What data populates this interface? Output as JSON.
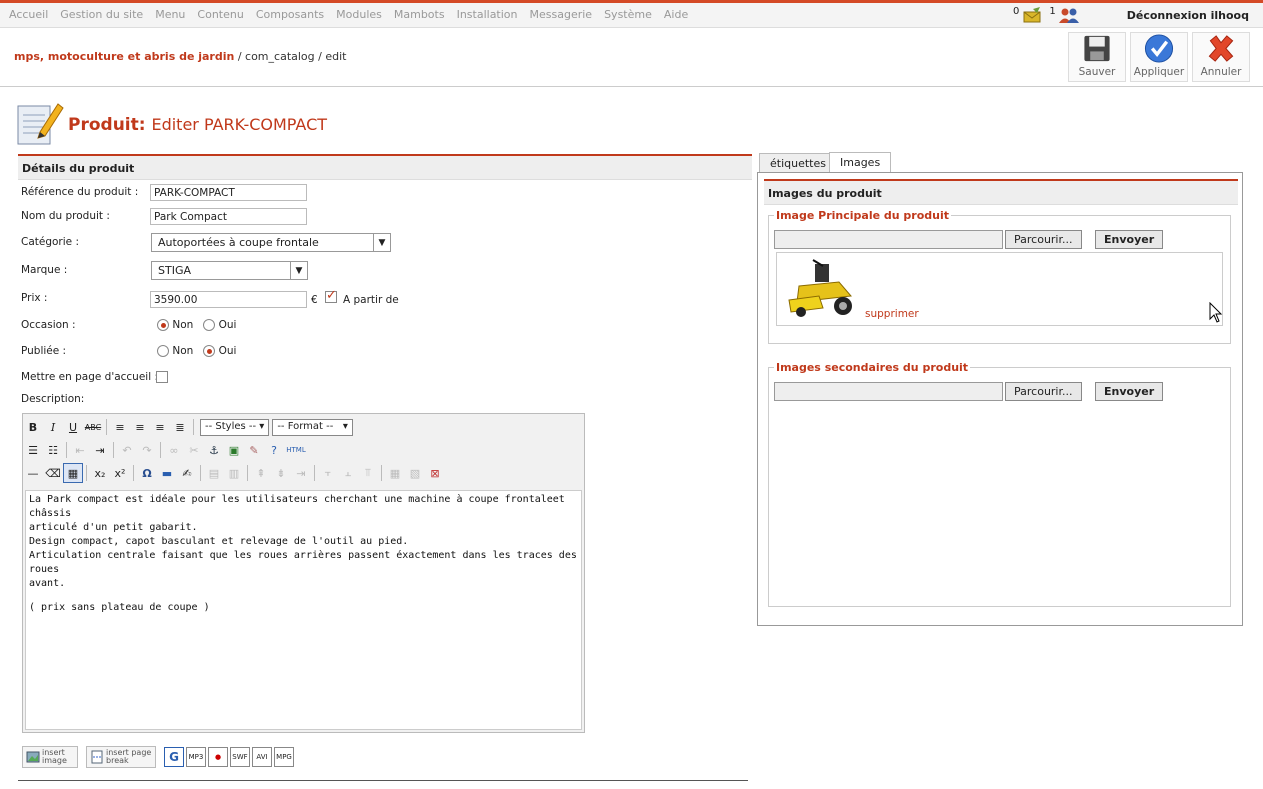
{
  "topmenu": [
    "Accueil",
    "Gestion du site",
    "Menu",
    "Contenu",
    "Composants",
    "Modules",
    "Mambots",
    "Installation",
    "Messagerie",
    "Système",
    "Aide"
  ],
  "stats": {
    "messages": "0",
    "users": "1"
  },
  "logout": "Déconnexion ilhooq",
  "breadcrumb": {
    "site": "mps, motoculture et abris de jardin",
    "path": "/ com_catalog / edit"
  },
  "toolbar": {
    "save": "Sauver",
    "apply": "Appliquer",
    "cancel": "Annuler"
  },
  "page_title": {
    "prefix": "Produit:",
    "text": "Editer PARK-COMPACT"
  },
  "left": {
    "header": "Détails du produit",
    "ref_label": "Référence du produit :",
    "ref_value": "PARK-COMPACT",
    "name_label": "Nom du produit :",
    "name_value": "Park Compact",
    "cat_label": "Catégorie :",
    "cat_value": "Autoportées à coupe frontale",
    "brand_label": "Marque :",
    "brand_value": "STIGA",
    "price_label": "Prix :",
    "price_value": "3590.00",
    "currency": "€",
    "from_label": "A partir de",
    "occasion_label": "Occasion :",
    "published_label": "Publiée :",
    "no": "Non",
    "yes": "Oui",
    "home_label": "Mettre en page d'accueil :",
    "desc_label": "Description:"
  },
  "editor": {
    "styles": "-- Styles --",
    "format": "-- Format --",
    "lines": [
      "La Park compact est idéale pour les utilisateurs cherchant une machine à coupe frontaleet châssis",
      "articulé d'un petit gabarit.",
      "Design compact, capot basculant et relevage de l'outil au pied.",
      "Articulation centrale faisant que les roues arrières passent éxactement dans les traces des roues",
      "avant.",
      "( prix sans plateau de coupe )"
    ],
    "insert_image": "insert image",
    "insert_break": "insert page break",
    "plugin_g": "G",
    "plugin_mp3": "MP3",
    "plugin_swf": "SWF",
    "plugin_avi": "AVI",
    "plugin_mpg": "MPG"
  },
  "right": {
    "tab1": "étiquettes",
    "tab2": "Images",
    "header": "Images du produit",
    "main_legend": "Image Principale du produit",
    "secondary_legend": "Images secondaires du produit",
    "browse": "Parcourir...",
    "send": "Envoyer",
    "delete": "supprimer"
  }
}
